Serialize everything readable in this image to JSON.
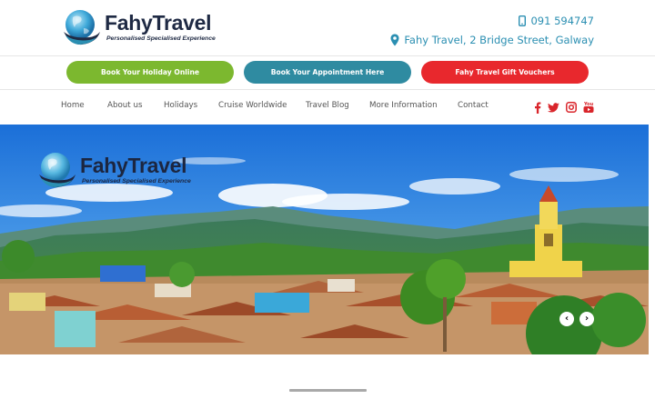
{
  "brand": {
    "name": "FahyTravel",
    "tagline": "Personalised Specialised Experience"
  },
  "contact": {
    "phone": "091 594747",
    "address": "Fahy Travel, 2 Bridge Street, Galway",
    "color": "#2b8fb2"
  },
  "cta_buttons": {
    "book_holiday": "Book Your Holiday Online",
    "book_appointment": "Book Your Appointment Here",
    "gift_vouchers": "Fahy Travel Gift Vouchers"
  },
  "nav": {
    "items": [
      "Home",
      "About us",
      "Holidays",
      "Cruise Worldwide",
      "Travel Blog",
      "More Information",
      "Contact"
    ]
  },
  "social": {
    "icons": [
      "facebook-icon",
      "twitter-icon",
      "instagram-icon",
      "youtube-icon"
    ],
    "color": "#d9252b"
  },
  "hero": {
    "controls": {
      "prev": "‹",
      "next": "›"
    }
  },
  "colors": {
    "green": "#7cb82f",
    "teal": "#2f8ba1",
    "red": "#e8282d",
    "navy": "#1f2a44"
  }
}
